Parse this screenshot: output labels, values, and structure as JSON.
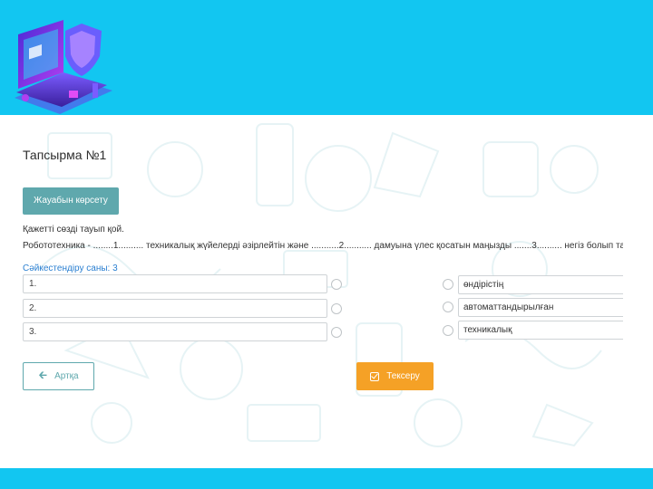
{
  "header": {
    "logo_icon": "laptop-shield-icon",
    "band_color": "#12c6f1"
  },
  "task": {
    "title": "Тапсырма №1",
    "show_answer_label": "Жауабын көрсету",
    "instruction": "Қажетті сөзді тауып қой.",
    "text": "Робототехника - ........1.......... техникалық жүйелерді әзірлейтін және ...........2........... дамуына үлес қосатын маңызды .......3.......... негіз болып табылатын ғылым.",
    "count_label": "Сәйкестендіру саны: 3"
  },
  "slots": [
    {
      "label": "1."
    },
    {
      "label": "2."
    },
    {
      "label": "3."
    }
  ],
  "options": [
    {
      "label": "өндірістің"
    },
    {
      "label": "автоматтандырылған"
    },
    {
      "label": "техникалық"
    }
  ],
  "nav": {
    "back_label": "Артқа",
    "check_label": "Тексеру",
    "back_color": "#5fa8ad",
    "check_color": "#f5a126"
  }
}
